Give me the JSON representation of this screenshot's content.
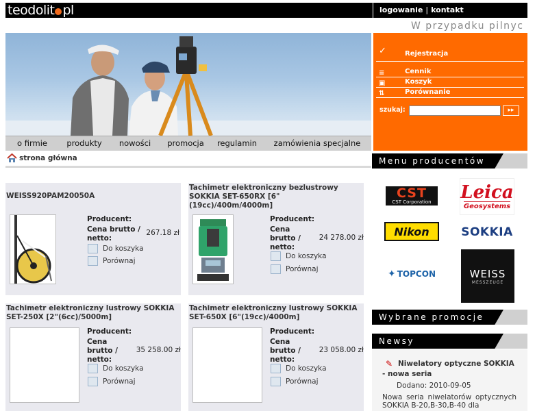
{
  "header": {
    "logo_text_left": "teodolit",
    "logo_text_right": "pl",
    "login": "logowanie",
    "separator": "|",
    "contact": "kontakt",
    "marquee": "W przypadku pilnyc"
  },
  "nav": [
    "o firmie",
    "produkty",
    "nowości",
    "promocja",
    "regulamin",
    "zamówienia specjalne"
  ],
  "breadcrumb": "strona główna",
  "side_menu": {
    "register": "Rejestracja",
    "price_list": "Cennik",
    "cart": "Koszyk",
    "compare": "Porównanie",
    "search_label": "szukaj:",
    "search_value": "",
    "search_button": "▸▸"
  },
  "labels": {
    "producer": "Producent:",
    "to_cart": "Do koszyka",
    "compare": "Porównaj"
  },
  "products": [
    {
      "title": "WEISS920PAM20050A",
      "price_label": "Cena brutto / netto:",
      "price": "267.18 zł"
    },
    {
      "title": "Tachimetr elektroniczny bezlustrowy SOKKIA SET-650RX [6\"(19cc)/400m/4000m]",
      "price_label": "Cena brutto / netto:",
      "price": "24 278.00 zł"
    },
    {
      "title": "Tachimetr elektroniczny lustrowy SOKKIA SET-250X [2\"(6cc)/5000m]",
      "price_label": "Cena brutto / netto:",
      "price": "35 258.00 zł"
    },
    {
      "title": "Tachimetr elektroniczny lustrowy SOKKIA SET-650X [6\"(19cc)/4000m]",
      "price_label": "Cena brutto / netto:",
      "price": "23 058.00 zł"
    }
  ],
  "sections": {
    "producers": "Menu producentów",
    "promotions": "Wybrane promocje",
    "news": "Newsy"
  },
  "brands": {
    "cst": "CST",
    "cst_sub": "CST Corporation",
    "leica": "Leica",
    "leica_sub": "Geosystems",
    "nikon": "Nikon",
    "sokkia": "SOKKIA",
    "topcon": "TOPCON",
    "weiss": "WEISS",
    "weiss_sub": "MESSZEUGE"
  },
  "news": {
    "title": "Niwelatory optyczne SOKKIA",
    "title_cont": "- nowa seria",
    "date": "Dodano: 2010-09-05",
    "body": "Nowa seria niwelatorów optycznych SOKKIA B-20,B-30,B-40 dla"
  },
  "colors": {
    "accent": "#ff6a00",
    "topbar": "#000000",
    "card_bg": "#e9e9ef",
    "nav_bg": "#cfcfcf"
  }
}
